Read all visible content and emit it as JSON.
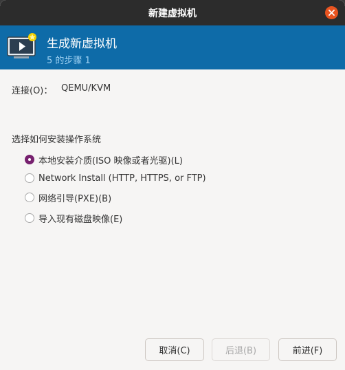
{
  "window": {
    "title": "新建虚拟机"
  },
  "header": {
    "title": "生成新虚拟机",
    "subtitle": "5 的步骤 1"
  },
  "connection": {
    "label": "连接(O)：",
    "value": "QEMU/KVM"
  },
  "install": {
    "title": "选择如何安装操作系统",
    "options": [
      {
        "label": "本地安装介质(ISO 映像或者光驱)(L)",
        "checked": true
      },
      {
        "label": "Network Install (HTTP, HTTPS, or FTP)",
        "checked": false
      },
      {
        "label": "网络引导(PXE)(B)",
        "checked": false
      },
      {
        "label": "导入现有磁盘映像(E)",
        "checked": false
      }
    ]
  },
  "buttons": {
    "cancel": "取消(C)",
    "back": "后退(B)",
    "forward": "前进(F)"
  },
  "colors": {
    "titlebar": "#2c2c2c",
    "header": "#0e6ba8",
    "accent": "#77216f",
    "close": "#e95420"
  }
}
